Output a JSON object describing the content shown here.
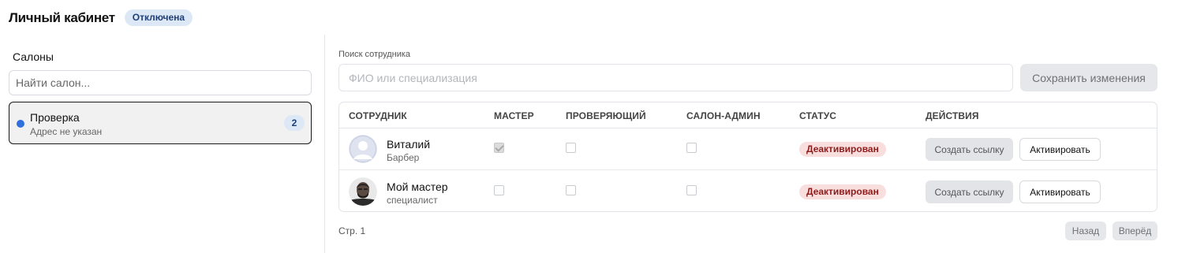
{
  "header": {
    "title": "Личный кабинет",
    "status": "Отключена"
  },
  "salons": {
    "title": "Салоны",
    "search_placeholder": "Найти салон...",
    "items": [
      {
        "name": "Проверка",
        "address": "Адрес не указан",
        "count": "2"
      }
    ]
  },
  "search": {
    "label": "Поиск сотрудника",
    "placeholder": "ФИО или специализация",
    "save_label": "Сохранить изменения"
  },
  "table": {
    "headers": [
      "СОТРУДНИК",
      "МАСТЕР",
      "ПРОВЕРЯЮЩИЙ",
      "САЛОН-АДМИН",
      "СТАТУС",
      "ДЕЙСТВИЯ"
    ],
    "rows": [
      {
        "name": "Виталий",
        "specialty": "Барбер",
        "master": true,
        "reviewer": false,
        "salon_admin": false,
        "status": "Деактивирован",
        "link_label": "Создать ссылку",
        "action_label": "Активировать"
      },
      {
        "name": "Мой мастер",
        "specialty": "специалист",
        "master": false,
        "reviewer": false,
        "salon_admin": false,
        "status": "Деактивирован",
        "link_label": "Создать ссылку",
        "action_label": "Активировать"
      }
    ]
  },
  "pagination": {
    "page": "Стр. 1",
    "prev_label": "Назад",
    "next_label": "Вперёд"
  },
  "colors": {
    "accent": "#2f6fde",
    "badge_blue": "#dde8f7",
    "status_red_bg": "#f9dede",
    "status_red_text": "#8f1c1c"
  }
}
